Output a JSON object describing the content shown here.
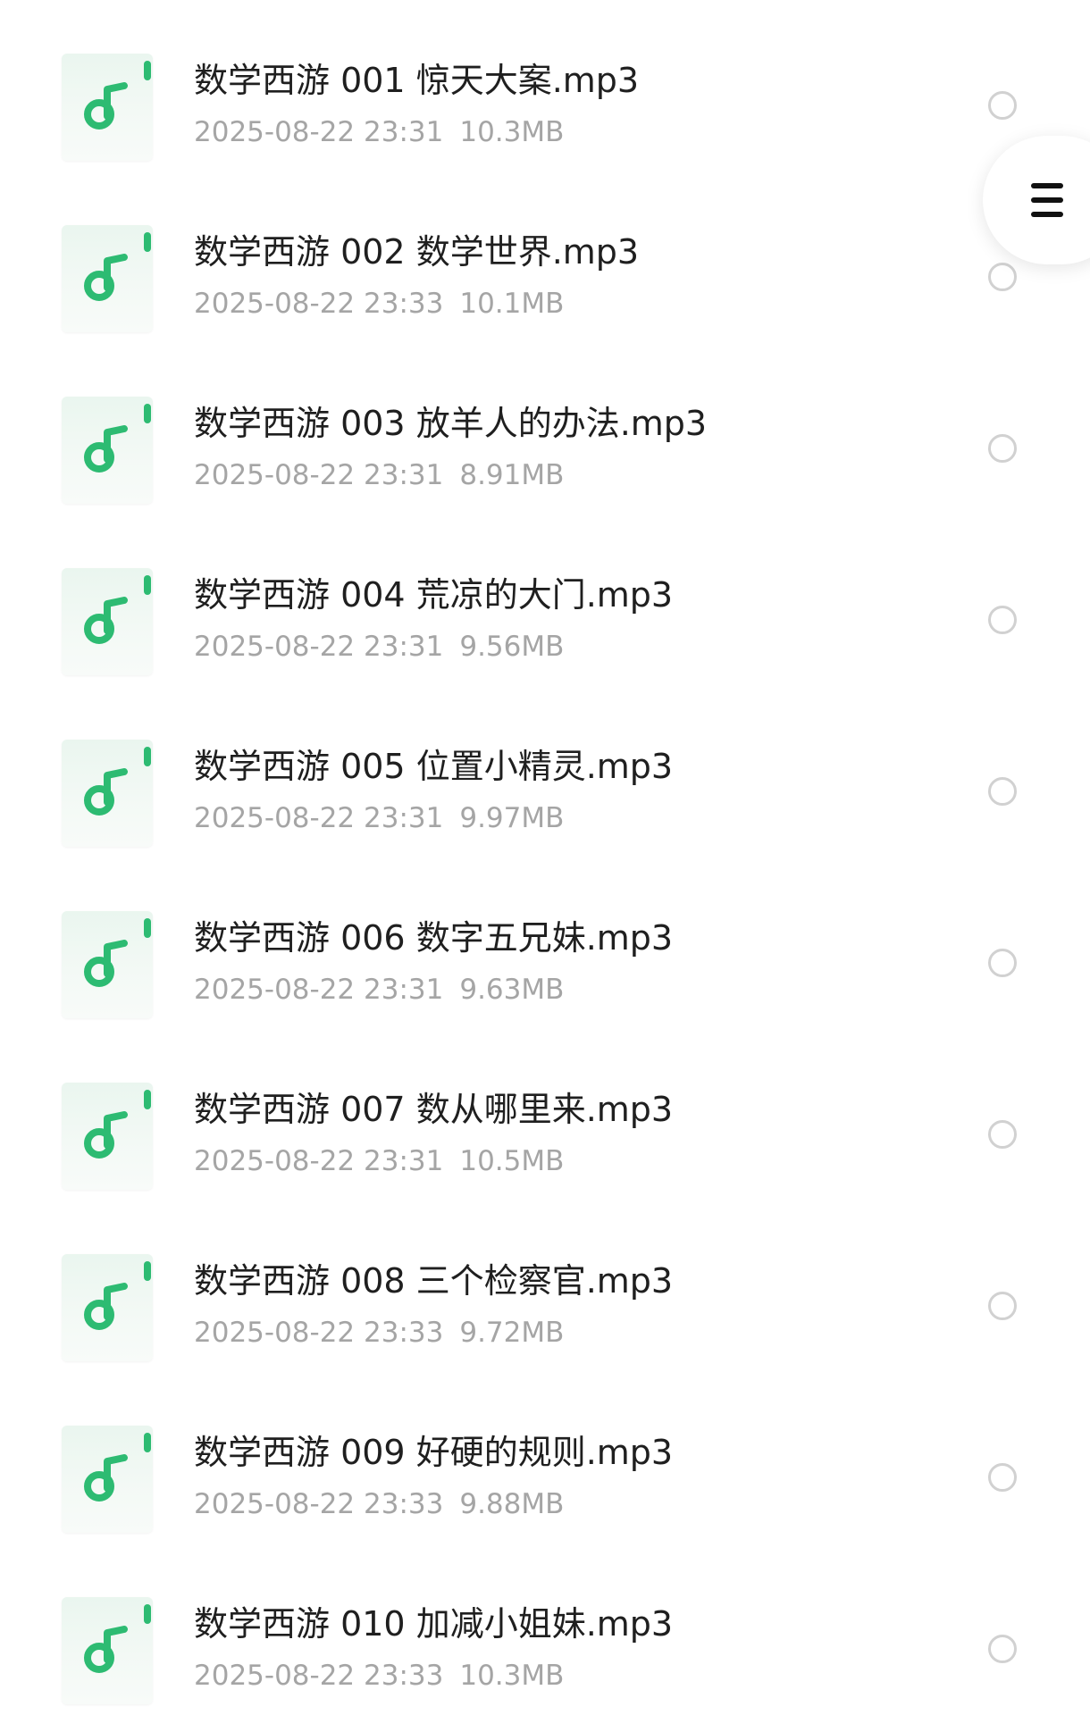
{
  "colors": {
    "accent_green": "#2dbb72",
    "title_text": "#1f1f1f",
    "meta_text": "#a5a5a5",
    "checkbox_border": "#d1d1d1"
  },
  "icons": {
    "file_thumbnail": "music-note-icon",
    "menu": "hamburger-menu-icon",
    "select": "radio-circle-icon"
  },
  "files": [
    {
      "name": "数学西游 001 惊天大案.mp3",
      "date": "2025-08-22 23:31",
      "size": "10.3MB"
    },
    {
      "name": "数学西游 002 数学世界.mp3",
      "date": "2025-08-22 23:33",
      "size": "10.1MB"
    },
    {
      "name": "数学西游 003 放羊人的办法.mp3",
      "date": "2025-08-22 23:31",
      "size": "8.91MB"
    },
    {
      "name": "数学西游 004 荒凉的大门.mp3",
      "date": "2025-08-22 23:31",
      "size": "9.56MB"
    },
    {
      "name": "数学西游 005 位置小精灵.mp3",
      "date": "2025-08-22 23:31",
      "size": "9.97MB"
    },
    {
      "name": "数学西游 006 数字五兄妹.mp3",
      "date": "2025-08-22 23:31",
      "size": "9.63MB"
    },
    {
      "name": "数学西游 007 数从哪里来.mp3",
      "date": "2025-08-22 23:31",
      "size": "10.5MB"
    },
    {
      "name": "数学西游 008 三个检察官.mp3",
      "date": "2025-08-22 23:33",
      "size": "9.72MB"
    },
    {
      "name": "数学西游 009 好硬的规则.mp3",
      "date": "2025-08-22 23:33",
      "size": "9.88MB"
    },
    {
      "name": "数学西游 010 加减小姐妹.mp3",
      "date": "2025-08-22 23:33",
      "size": "10.3MB"
    }
  ]
}
